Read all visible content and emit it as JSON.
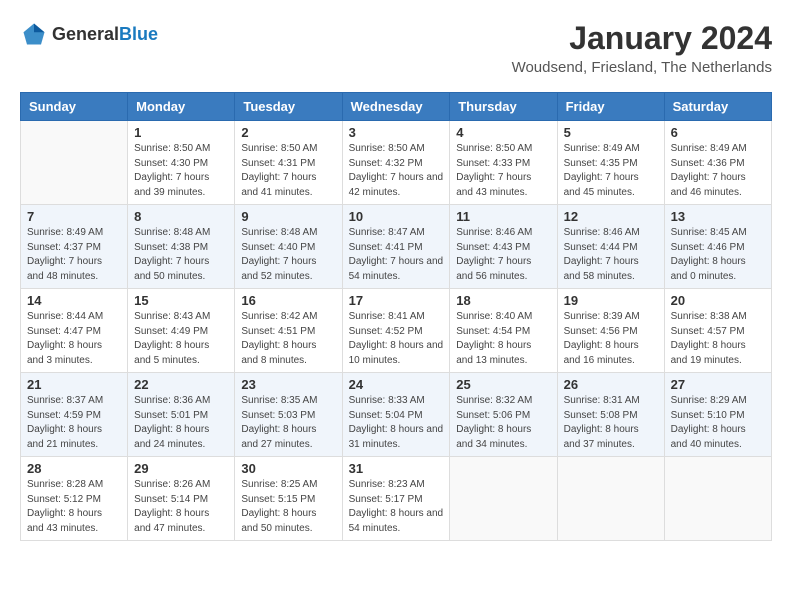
{
  "header": {
    "logo_general": "General",
    "logo_blue": "Blue",
    "month": "January 2024",
    "location": "Woudsend, Friesland, The Netherlands"
  },
  "days_of_week": [
    "Sunday",
    "Monday",
    "Tuesday",
    "Wednesday",
    "Thursday",
    "Friday",
    "Saturday"
  ],
  "weeks": [
    [
      {
        "day": "",
        "sunrise": "",
        "sunset": "",
        "daylight": ""
      },
      {
        "day": "1",
        "sunrise": "Sunrise: 8:50 AM",
        "sunset": "Sunset: 4:30 PM",
        "daylight": "Daylight: 7 hours and 39 minutes."
      },
      {
        "day": "2",
        "sunrise": "Sunrise: 8:50 AM",
        "sunset": "Sunset: 4:31 PM",
        "daylight": "Daylight: 7 hours and 41 minutes."
      },
      {
        "day": "3",
        "sunrise": "Sunrise: 8:50 AM",
        "sunset": "Sunset: 4:32 PM",
        "daylight": "Daylight: 7 hours and 42 minutes."
      },
      {
        "day": "4",
        "sunrise": "Sunrise: 8:50 AM",
        "sunset": "Sunset: 4:33 PM",
        "daylight": "Daylight: 7 hours and 43 minutes."
      },
      {
        "day": "5",
        "sunrise": "Sunrise: 8:49 AM",
        "sunset": "Sunset: 4:35 PM",
        "daylight": "Daylight: 7 hours and 45 minutes."
      },
      {
        "day": "6",
        "sunrise": "Sunrise: 8:49 AM",
        "sunset": "Sunset: 4:36 PM",
        "daylight": "Daylight: 7 hours and 46 minutes."
      }
    ],
    [
      {
        "day": "7",
        "sunrise": "Sunrise: 8:49 AM",
        "sunset": "Sunset: 4:37 PM",
        "daylight": "Daylight: 7 hours and 48 minutes."
      },
      {
        "day": "8",
        "sunrise": "Sunrise: 8:48 AM",
        "sunset": "Sunset: 4:38 PM",
        "daylight": "Daylight: 7 hours and 50 minutes."
      },
      {
        "day": "9",
        "sunrise": "Sunrise: 8:48 AM",
        "sunset": "Sunset: 4:40 PM",
        "daylight": "Daylight: 7 hours and 52 minutes."
      },
      {
        "day": "10",
        "sunrise": "Sunrise: 8:47 AM",
        "sunset": "Sunset: 4:41 PM",
        "daylight": "Daylight: 7 hours and 54 minutes."
      },
      {
        "day": "11",
        "sunrise": "Sunrise: 8:46 AM",
        "sunset": "Sunset: 4:43 PM",
        "daylight": "Daylight: 7 hours and 56 minutes."
      },
      {
        "day": "12",
        "sunrise": "Sunrise: 8:46 AM",
        "sunset": "Sunset: 4:44 PM",
        "daylight": "Daylight: 7 hours and 58 minutes."
      },
      {
        "day": "13",
        "sunrise": "Sunrise: 8:45 AM",
        "sunset": "Sunset: 4:46 PM",
        "daylight": "Daylight: 8 hours and 0 minutes."
      }
    ],
    [
      {
        "day": "14",
        "sunrise": "Sunrise: 8:44 AM",
        "sunset": "Sunset: 4:47 PM",
        "daylight": "Daylight: 8 hours and 3 minutes."
      },
      {
        "day": "15",
        "sunrise": "Sunrise: 8:43 AM",
        "sunset": "Sunset: 4:49 PM",
        "daylight": "Daylight: 8 hours and 5 minutes."
      },
      {
        "day": "16",
        "sunrise": "Sunrise: 8:42 AM",
        "sunset": "Sunset: 4:51 PM",
        "daylight": "Daylight: 8 hours and 8 minutes."
      },
      {
        "day": "17",
        "sunrise": "Sunrise: 8:41 AM",
        "sunset": "Sunset: 4:52 PM",
        "daylight": "Daylight: 8 hours and 10 minutes."
      },
      {
        "day": "18",
        "sunrise": "Sunrise: 8:40 AM",
        "sunset": "Sunset: 4:54 PM",
        "daylight": "Daylight: 8 hours and 13 minutes."
      },
      {
        "day": "19",
        "sunrise": "Sunrise: 8:39 AM",
        "sunset": "Sunset: 4:56 PM",
        "daylight": "Daylight: 8 hours and 16 minutes."
      },
      {
        "day": "20",
        "sunrise": "Sunrise: 8:38 AM",
        "sunset": "Sunset: 4:57 PM",
        "daylight": "Daylight: 8 hours and 19 minutes."
      }
    ],
    [
      {
        "day": "21",
        "sunrise": "Sunrise: 8:37 AM",
        "sunset": "Sunset: 4:59 PM",
        "daylight": "Daylight: 8 hours and 21 minutes."
      },
      {
        "day": "22",
        "sunrise": "Sunrise: 8:36 AM",
        "sunset": "Sunset: 5:01 PM",
        "daylight": "Daylight: 8 hours and 24 minutes."
      },
      {
        "day": "23",
        "sunrise": "Sunrise: 8:35 AM",
        "sunset": "Sunset: 5:03 PM",
        "daylight": "Daylight: 8 hours and 27 minutes."
      },
      {
        "day": "24",
        "sunrise": "Sunrise: 8:33 AM",
        "sunset": "Sunset: 5:04 PM",
        "daylight": "Daylight: 8 hours and 31 minutes."
      },
      {
        "day": "25",
        "sunrise": "Sunrise: 8:32 AM",
        "sunset": "Sunset: 5:06 PM",
        "daylight": "Daylight: 8 hours and 34 minutes."
      },
      {
        "day": "26",
        "sunrise": "Sunrise: 8:31 AM",
        "sunset": "Sunset: 5:08 PM",
        "daylight": "Daylight: 8 hours and 37 minutes."
      },
      {
        "day": "27",
        "sunrise": "Sunrise: 8:29 AM",
        "sunset": "Sunset: 5:10 PM",
        "daylight": "Daylight: 8 hours and 40 minutes."
      }
    ],
    [
      {
        "day": "28",
        "sunrise": "Sunrise: 8:28 AM",
        "sunset": "Sunset: 5:12 PM",
        "daylight": "Daylight: 8 hours and 43 minutes."
      },
      {
        "day": "29",
        "sunrise": "Sunrise: 8:26 AM",
        "sunset": "Sunset: 5:14 PM",
        "daylight": "Daylight: 8 hours and 47 minutes."
      },
      {
        "day": "30",
        "sunrise": "Sunrise: 8:25 AM",
        "sunset": "Sunset: 5:15 PM",
        "daylight": "Daylight: 8 hours and 50 minutes."
      },
      {
        "day": "31",
        "sunrise": "Sunrise: 8:23 AM",
        "sunset": "Sunset: 5:17 PM",
        "daylight": "Daylight: 8 hours and 54 minutes."
      },
      {
        "day": "",
        "sunrise": "",
        "sunset": "",
        "daylight": ""
      },
      {
        "day": "",
        "sunrise": "",
        "sunset": "",
        "daylight": ""
      },
      {
        "day": "",
        "sunrise": "",
        "sunset": "",
        "daylight": ""
      }
    ]
  ]
}
